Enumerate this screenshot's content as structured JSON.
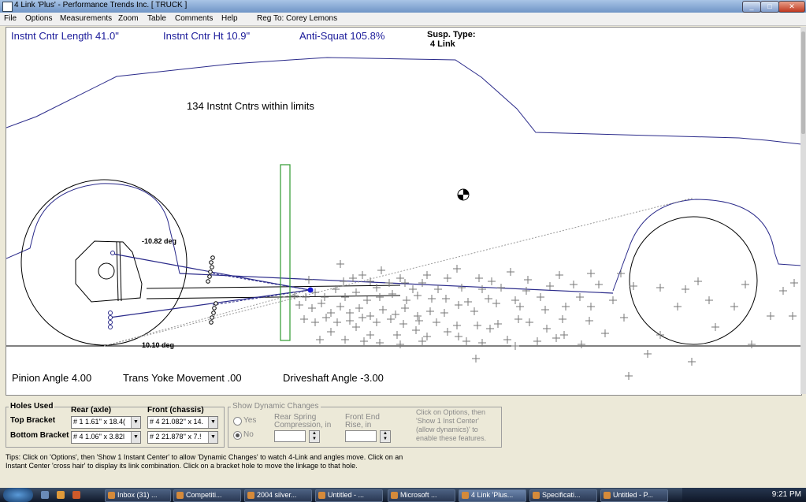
{
  "window": {
    "title": "4 Link 'Plus' - Performance Trends Inc.  [ TRUCK ]"
  },
  "menu": [
    "File",
    "Options",
    "Measurements",
    "Zoom",
    "Table",
    "Comments",
    "Help",
    "Reg To: Corey Lemons"
  ],
  "stats": {
    "ic_length": "Instnt Cntr Length 41.0\"",
    "ic_height": "Instnt Cntr Ht  10.9\"",
    "anti_squat": "Anti-Squat  105.8%",
    "susp_type_label": "Susp. Type:",
    "susp_type_value": "4 Link"
  },
  "ic_count": "134 Instnt Cntrs within limits",
  "angles": {
    "top": "-10.82 deg",
    "bottom": "10.10 deg"
  },
  "bottom_readout": {
    "pinion": "Pinion Angle  4.00",
    "trans_yoke": "Trans Yoke Movement .00",
    "driveshaft": "Driveshaft Angle -3.00"
  },
  "holes": {
    "group_label": "Holes Used",
    "rear_header": "Rear (axle)",
    "front_header": "Front (chassis)",
    "top_label": "Top Bracket",
    "bottom_label": "Bottom Bracket",
    "top_rear": "# 1   1.61'' x 18.4(",
    "top_front": "# 4   21.082'' x 14.",
    "bottom_rear": "# 4   1.06'' x 3.82l",
    "bottom_front": "# 2   21.878'' x 7.!"
  },
  "dynamic": {
    "group_label": "Show Dynamic Changes",
    "yes": "Yes",
    "no": "No",
    "rear_spring_1": "Rear Spring",
    "rear_spring_2": "Compression, in",
    "front_end_1": "Front End",
    "front_end_2": "Rise, in",
    "note_1": "Click on Options, then",
    "note_2": "'Show 1 Inst Center'",
    "note_3": "(allow dynamics)' to",
    "note_4": "enable these features."
  },
  "tips": {
    "line1": "Tips:  Click on 'Options', then 'Show 1 Instant Center' to allow 'Dynamic Changes' to watch 4-Link and angles move.  Click on an",
    "line2": "Instant Center 'cross hair' to display its link combination.  Click on a bracket hole to move the linkage to that hole."
  },
  "taskbar": {
    "items": [
      "Inbox (31) ...",
      "Competiti...",
      "2004 silver...",
      "Untitled - ...",
      "Microsoft ...",
      "4 Link 'Plus...",
      "Specificati...",
      "Untitled - P..."
    ],
    "clock": "9:21 PM"
  }
}
